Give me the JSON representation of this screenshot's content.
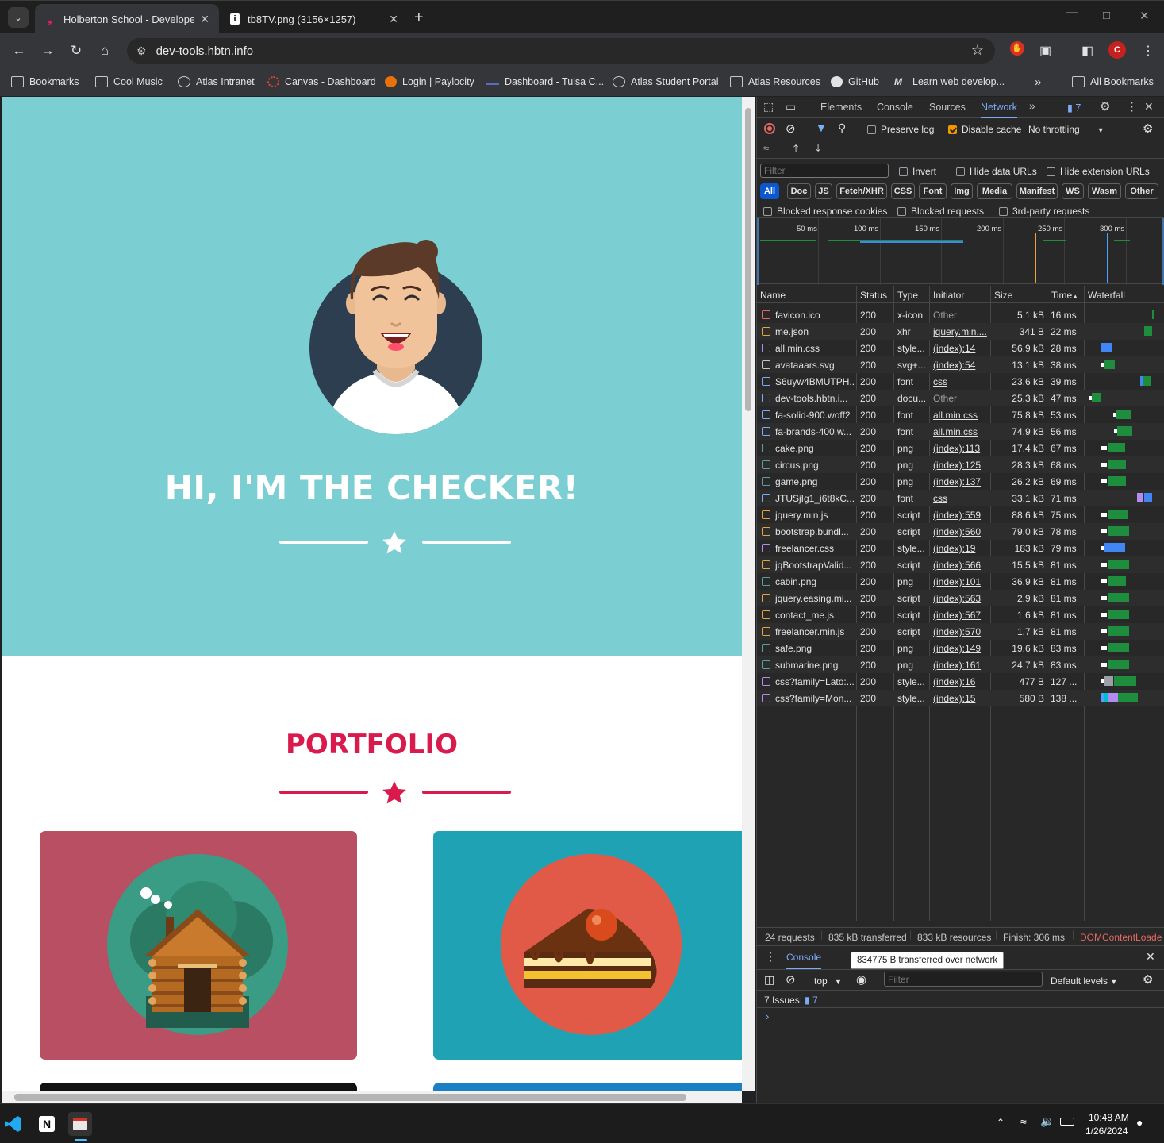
{
  "browser": {
    "tabs": [
      {
        "title": "Holberton School - Developer t",
        "active": true
      },
      {
        "title": "tb8TV.png (3156×1257)",
        "active": false
      }
    ],
    "url": "dev-tools.hbtn.info",
    "profile_initial": "C",
    "bookmarks": [
      {
        "label": "Bookmarks",
        "icon": "folder-icon"
      },
      {
        "label": "Cool Music",
        "icon": "folder-icon"
      },
      {
        "label": "Atlas Intranet",
        "icon": "globe-icon"
      },
      {
        "label": "Canvas - Dashboard",
        "icon": "canvas-icon"
      },
      {
        "label": "Login | Paylocity",
        "icon": "paylocity-icon"
      },
      {
        "label": "Dashboard - Tulsa C...",
        "icon": "dashboard-icon"
      },
      {
        "label": "Atlas Student Portal",
        "icon": "globe-icon"
      },
      {
        "label": "Atlas Resources",
        "icon": "folder-icon"
      },
      {
        "label": "GitHub",
        "icon": "github-icon"
      },
      {
        "label": "Learn web develop...",
        "icon": "mdn-icon"
      }
    ],
    "all_bookmarks": "All Bookmarks"
  },
  "page": {
    "hero_title": "HI, I'M THE CHECKER!",
    "portfolio_title": "PORTFOLIO",
    "colors": {
      "hero_bg": "#7bced2",
      "accent": "#d81b4c"
    }
  },
  "devtools": {
    "tabs": [
      "Elements",
      "Console",
      "Sources",
      "Network"
    ],
    "active_tab": "Network",
    "issues_badge": "7",
    "toolbar": {
      "preserve_log": "Preserve log",
      "disable_cache": "Disable cache",
      "throttling": "No throttling"
    },
    "filter": {
      "placeholder": "Filter",
      "invert": "Invert",
      "hide_data_urls": "Hide data URLs",
      "hide_extension_urls": "Hide extension URLs"
    },
    "type_filters": [
      "All",
      "Doc",
      "JS",
      "Fetch/XHR",
      "CSS",
      "Font",
      "Img",
      "Media",
      "Manifest",
      "WS",
      "Wasm",
      "Other"
    ],
    "checks": {
      "blocked_cookies": "Blocked response cookies",
      "blocked_requests": "Blocked requests",
      "third_party": "3rd-party requests"
    },
    "overview_ticks": [
      "50 ms",
      "100 ms",
      "150 ms",
      "200 ms",
      "250 ms",
      "300 ms"
    ],
    "columns": [
      "Name",
      "Status",
      "Type",
      "Initiator",
      "Size",
      "Time",
      "Waterfall"
    ],
    "requests": [
      {
        "name": "favicon.ico",
        "status": "200",
        "type": "x-icon",
        "initiator": "Other",
        "size": "5.1 kB",
        "time": "16 ms"
      },
      {
        "name": "me.json",
        "status": "200",
        "type": "xhr",
        "initiator": "jquery.min....",
        "size": "341 B",
        "time": "22 ms"
      },
      {
        "name": "all.min.css",
        "status": "200",
        "type": "style...",
        "initiator": "(index):14",
        "size": "56.9 kB",
        "time": "28 ms"
      },
      {
        "name": "avataaars.svg",
        "status": "200",
        "type": "svg+...",
        "initiator": "(index):54",
        "size": "13.1 kB",
        "time": "38 ms"
      },
      {
        "name": "S6uyw4BMUTPH...",
        "status": "200",
        "type": "font",
        "initiator": "css",
        "size": "23.6 kB",
        "time": "39 ms"
      },
      {
        "name": "dev-tools.hbtn.i...",
        "status": "200",
        "type": "docu...",
        "initiator": "Other",
        "size": "25.3 kB",
        "time": "47 ms"
      },
      {
        "name": "fa-solid-900.woff2",
        "status": "200",
        "type": "font",
        "initiator": "all.min.css",
        "size": "75.8 kB",
        "time": "53 ms"
      },
      {
        "name": "fa-brands-400.w...",
        "status": "200",
        "type": "font",
        "initiator": "all.min.css",
        "size": "74.9 kB",
        "time": "56 ms"
      },
      {
        "name": "cake.png",
        "status": "200",
        "type": "png",
        "initiator": "(index):113",
        "size": "17.4 kB",
        "time": "67 ms"
      },
      {
        "name": "circus.png",
        "status": "200",
        "type": "png",
        "initiator": "(index):125",
        "size": "28.3 kB",
        "time": "68 ms"
      },
      {
        "name": "game.png",
        "status": "200",
        "type": "png",
        "initiator": "(index):137",
        "size": "26.2 kB",
        "time": "69 ms"
      },
      {
        "name": "JTUSjIg1_i6t8kC...",
        "status": "200",
        "type": "font",
        "initiator": "css",
        "size": "33.1 kB",
        "time": "71 ms"
      },
      {
        "name": "jquery.min.js",
        "status": "200",
        "type": "script",
        "initiator": "(index):559",
        "size": "88.6 kB",
        "time": "75 ms"
      },
      {
        "name": "bootstrap.bundl...",
        "status": "200",
        "type": "script",
        "initiator": "(index):560",
        "size": "79.0 kB",
        "time": "78 ms"
      },
      {
        "name": "freelancer.css",
        "status": "200",
        "type": "style...",
        "initiator": "(index):19",
        "size": "183 kB",
        "time": "79 ms"
      },
      {
        "name": "jqBootstrapValid...",
        "status": "200",
        "type": "script",
        "initiator": "(index):566",
        "size": "15.5 kB",
        "time": "81 ms"
      },
      {
        "name": "cabin.png",
        "status": "200",
        "type": "png",
        "initiator": "(index):101",
        "size": "36.9 kB",
        "time": "81 ms"
      },
      {
        "name": "jquery.easing.mi...",
        "status": "200",
        "type": "script",
        "initiator": "(index):563",
        "size": "2.9 kB",
        "time": "81 ms"
      },
      {
        "name": "contact_me.js",
        "status": "200",
        "type": "script",
        "initiator": "(index):567",
        "size": "1.6 kB",
        "time": "81 ms"
      },
      {
        "name": "freelancer.min.js",
        "status": "200",
        "type": "script",
        "initiator": "(index):570",
        "size": "1.7 kB",
        "time": "81 ms"
      },
      {
        "name": "safe.png",
        "status": "200",
        "type": "png",
        "initiator": "(index):149",
        "size": "19.6 kB",
        "time": "83 ms"
      },
      {
        "name": "submarine.png",
        "status": "200",
        "type": "png",
        "initiator": "(index):161",
        "size": "24.7 kB",
        "time": "83 ms"
      },
      {
        "name": "css?family=Lato:...",
        "status": "200",
        "type": "style...",
        "initiator": "(index):16",
        "size": "477 B",
        "time": "127 ..."
      },
      {
        "name": "css?family=Mon...",
        "status": "200",
        "type": "style...",
        "initiator": "(index):15",
        "size": "580 B",
        "time": "138 ..."
      }
    ],
    "summary": {
      "requests": "24 requests",
      "transferred": "835 kB transferred",
      "resources": "833 kB resources",
      "finish": "Finish: 306 ms",
      "dcl": "DOMContentLoade"
    },
    "drawer": {
      "tab": "Console",
      "tooltip": "834775 B transferred over network",
      "context": "top",
      "filter_placeholder": "Filter",
      "levels": "Default levels",
      "issues_label": "7 Issues:",
      "issues_count": "7"
    }
  },
  "taskbar": {
    "time": "10:48 AM",
    "date": "1/26/2024"
  }
}
